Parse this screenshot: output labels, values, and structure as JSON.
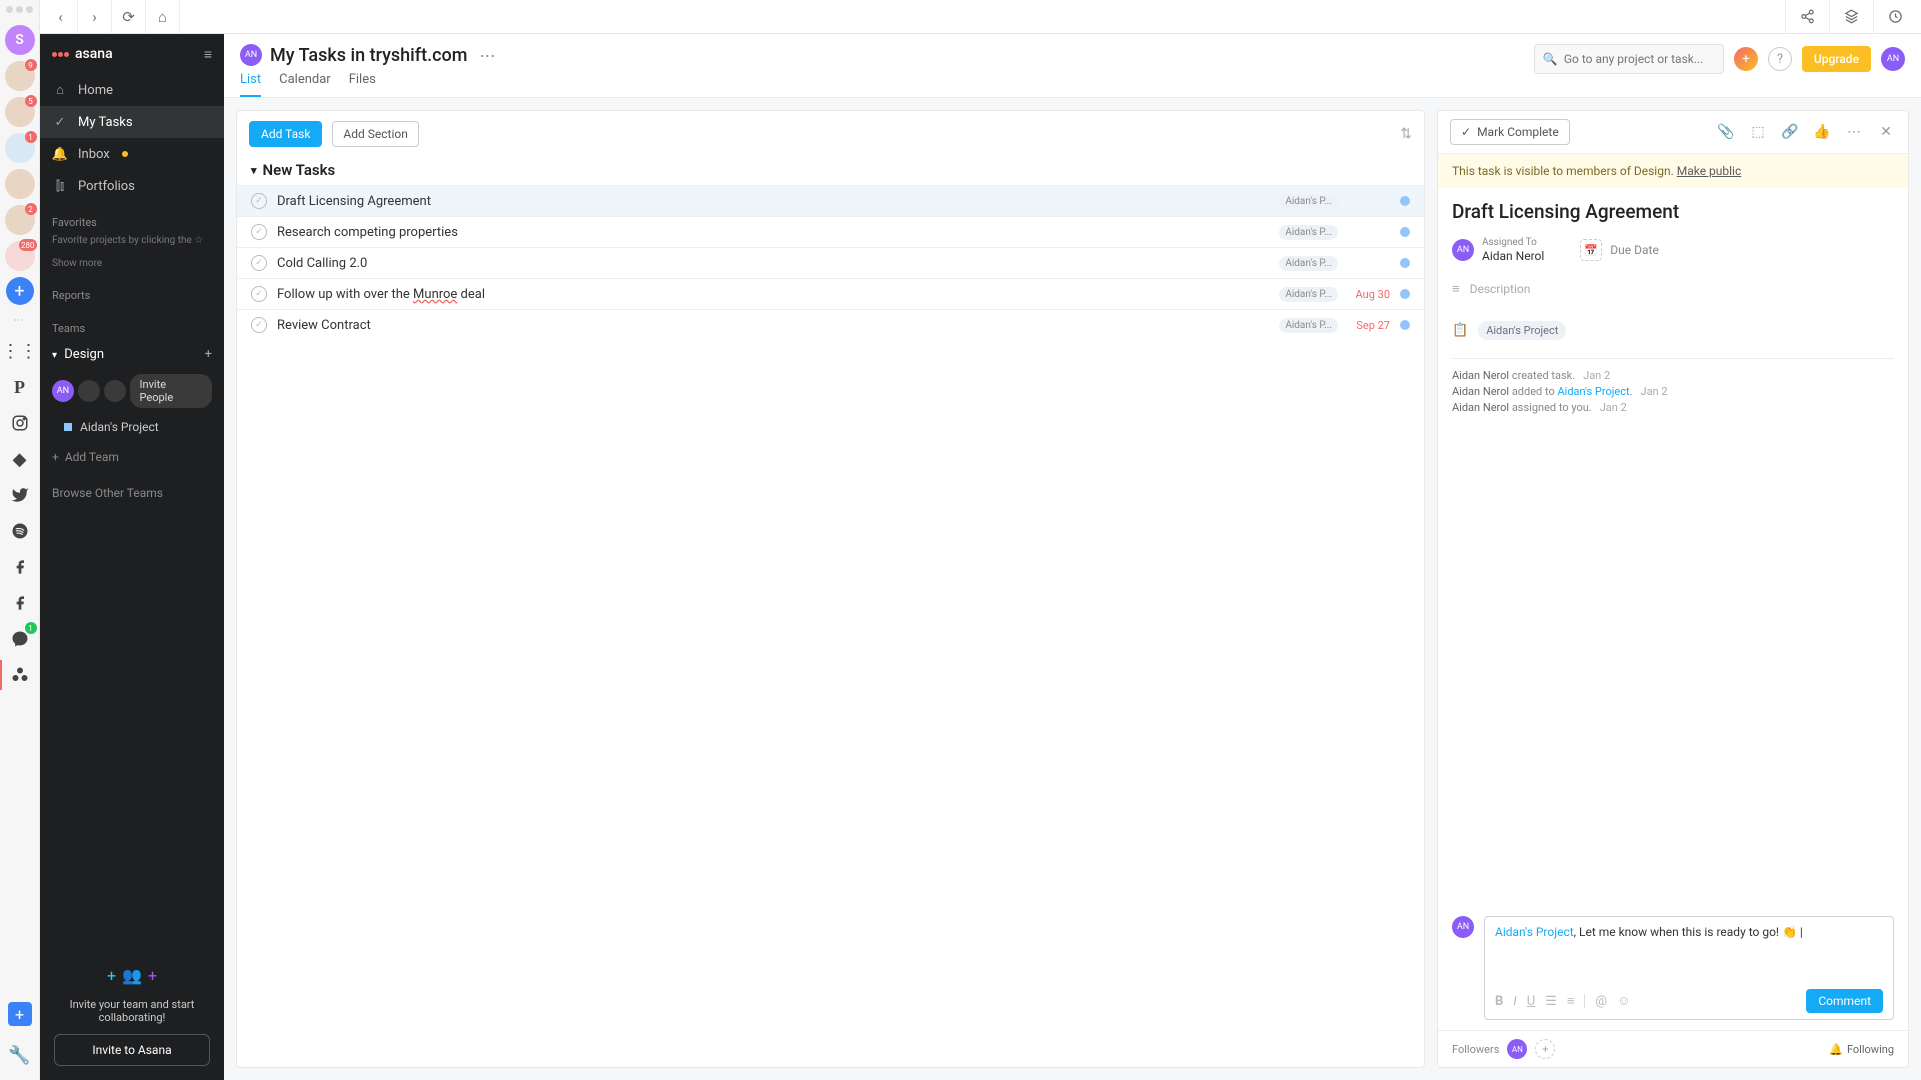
{
  "strip": {
    "main_initial": "S",
    "avatars": [
      {
        "badge": "9"
      },
      {
        "badge": "5"
      },
      {
        "badge": "1"
      },
      {
        "badge": ""
      },
      {
        "badge": "2"
      },
      {
        "badge": "280"
      }
    ]
  },
  "header": {
    "title": "My Tasks in tryshift.com",
    "tabs": {
      "list": "List",
      "calendar": "Calendar",
      "files": "Files"
    },
    "search_placeholder": "Go to any project or task...",
    "upgrade": "Upgrade",
    "avatar_initials": "AN"
  },
  "nav": {
    "logo": "asana",
    "home": "Home",
    "my_tasks": "My Tasks",
    "inbox": "Inbox",
    "portfolios": "Portfolios",
    "favorites": "Favorites",
    "fav_hint": "Favorite projects by clicking the ☆",
    "show_more": "Show more",
    "reports": "Reports",
    "teams": "Teams",
    "team_name": "Design",
    "invite_people": "Invite People",
    "project": "Aidan's Project",
    "add_team": "Add Team",
    "browse_teams": "Browse Other Teams",
    "invite_msg": "Invite your team and start collaborating!",
    "invite_btn": "Invite to Asana",
    "member_initials": "AN"
  },
  "list": {
    "add_task": "Add Task",
    "add_section": "Add Section",
    "section": "New Tasks",
    "project_short": "Aidan's P...",
    "tasks": [
      {
        "name": "Draft Licensing Agreement",
        "due": "",
        "selected": true
      },
      {
        "name": "Research competing properties",
        "due": ""
      },
      {
        "name": "Cold Calling 2.0",
        "due": ""
      },
      {
        "name": "Follow up with over the Munroe deal",
        "due": "Aug 30",
        "typo": true
      },
      {
        "name": "Review Contract",
        "due": "Sep 27"
      }
    ]
  },
  "detail": {
    "mark_complete": "Mark Complete",
    "visibility_text": "This task is visible to members of Design.",
    "make_public": "Make public",
    "title": "Draft Licensing Agreement",
    "assigned_to_label": "Assigned To",
    "assignee": "Aidan Nerol",
    "due_date_label": "Due Date",
    "description_placeholder": "Description",
    "project_chip": "Aidan's Project",
    "activity": [
      {
        "who": "Aidan Nerol",
        "text": "created task.",
        "date": "Jan 2"
      },
      {
        "who": "Aidan Nerol",
        "text": "added to",
        "link": "Aidan's Project",
        "suffix": ".",
        "date": "Jan 2"
      },
      {
        "who": "Aidan Nerol",
        "text": "assigned to you.",
        "date": "Jan 2"
      }
    ],
    "comment_mention": "Aidan's Project",
    "comment_rest": ", Let me know when this is ready to go! 👏 |",
    "comment_btn": "Comment",
    "followers_label": "Followers",
    "following": "Following",
    "avatar_initials": "AN"
  }
}
